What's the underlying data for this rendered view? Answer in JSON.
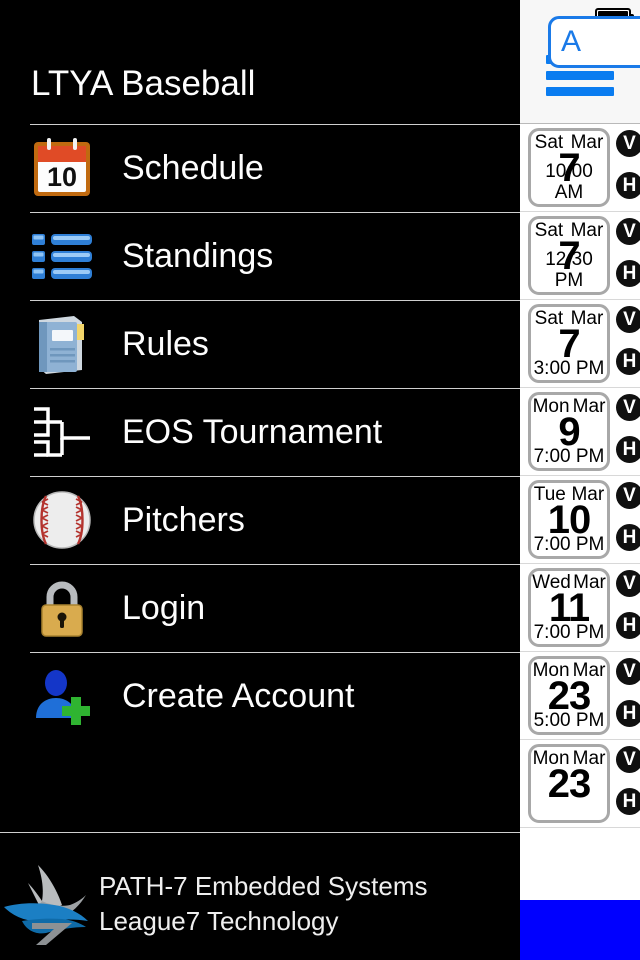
{
  "status_bar": {
    "battery_icon": "battery-full-icon"
  },
  "navbar": {
    "menu_icon": "hamburger-menu-icon"
  },
  "drawer": {
    "title": "LTYA Baseball",
    "items": [
      {
        "label": "Schedule",
        "icon": "calendar-icon",
        "icon_day": "10"
      },
      {
        "label": "Standings",
        "icon": "list-icon"
      },
      {
        "label": "Rules",
        "icon": "book-icon"
      },
      {
        "label": "EOS Tournament",
        "icon": "bracket-icon"
      },
      {
        "label": "Pitchers",
        "icon": "baseball-icon"
      },
      {
        "label": "Login",
        "icon": "lock-icon"
      },
      {
        "label": "Create Account",
        "icon": "add-user-icon"
      }
    ],
    "footer": {
      "logo": "path7-bird-logo",
      "line1": "PATH-7 Embedded Systems",
      "line2": "League7 Technology"
    }
  },
  "content": {
    "filter_button_label": "A",
    "games": [
      {
        "weekday": "Sat",
        "month": "Mar",
        "day": "7",
        "time": "10:00 AM",
        "visitor_badge": "V",
        "home_badge": "H"
      },
      {
        "weekday": "Sat",
        "month": "Mar",
        "day": "7",
        "time": "12:30 PM",
        "visitor_badge": "V",
        "home_badge": "H"
      },
      {
        "weekday": "Sat",
        "month": "Mar",
        "day": "7",
        "time": "3:00 PM",
        "visitor_badge": "V",
        "home_badge": "H"
      },
      {
        "weekday": "Mon",
        "month": "Mar",
        "day": "9",
        "time": "7:00 PM",
        "visitor_badge": "V",
        "home_badge": "H"
      },
      {
        "weekday": "Tue",
        "month": "Mar",
        "day": "10",
        "time": "7:00 PM",
        "visitor_badge": "V",
        "home_badge": "H"
      },
      {
        "weekday": "Wed",
        "month": "Mar",
        "day": "11",
        "time": "7:00 PM",
        "visitor_badge": "V",
        "home_badge": "H"
      },
      {
        "weekday": "Mon",
        "month": "Mar",
        "day": "23",
        "time": "5:00 PM",
        "visitor_badge": "V",
        "home_badge": "H"
      },
      {
        "weekday": "Mon",
        "month": "Mar",
        "day": "23",
        "time": "",
        "visitor_badge": "V",
        "home_badge": "H"
      }
    ]
  },
  "colors": {
    "accent_blue": "#0a7cf0",
    "button_blue": "#1a7ae8",
    "drawer_bg": "#000000",
    "panel_bg": "#ffffff",
    "block_blue": "#0000ff"
  }
}
